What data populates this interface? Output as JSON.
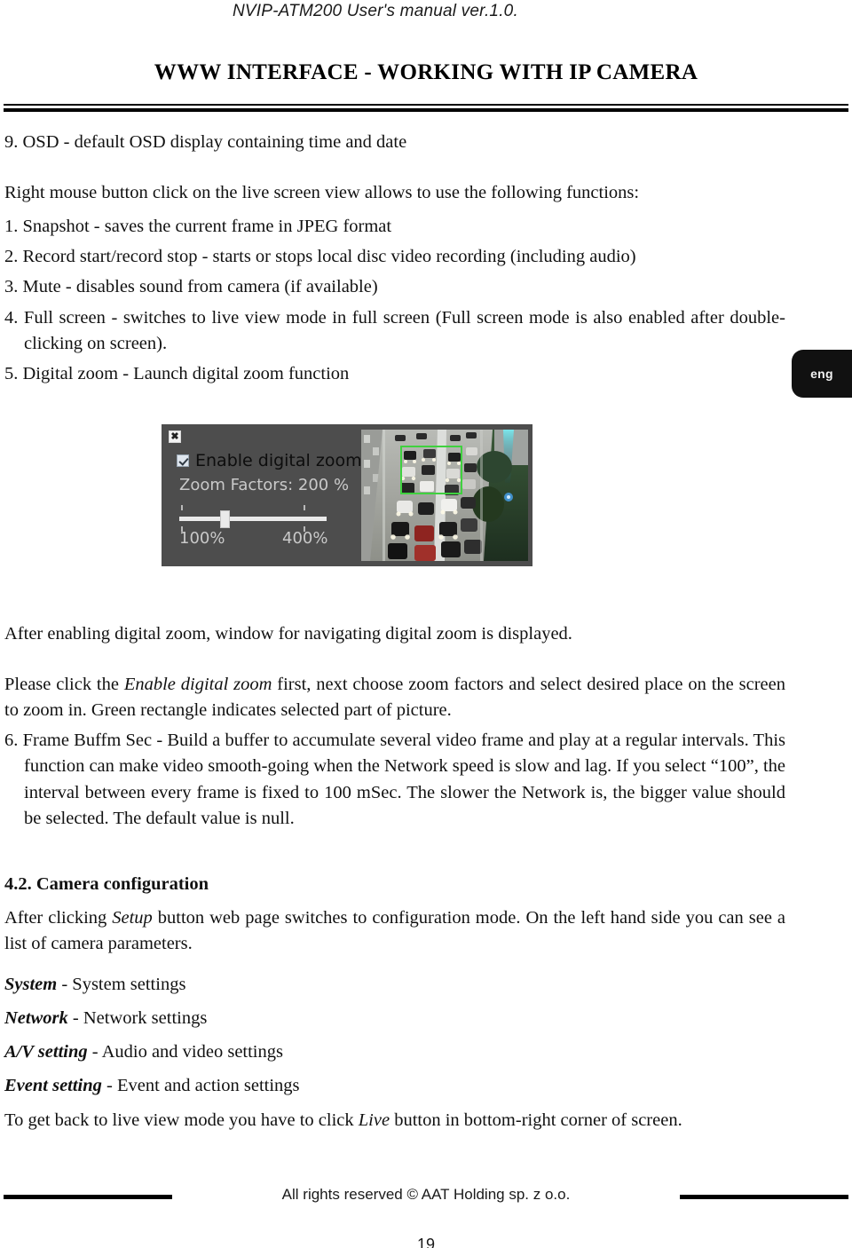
{
  "header": {
    "running_head": "NVIP-ATM200 User's manual ver.1.0.",
    "title": "WWW INTERFACE - WORKING WITH IP CAMERA"
  },
  "language_tab": {
    "label": "eng"
  },
  "body": {
    "item9": "9. OSD - default OSD display containing time and date",
    "intro": "Right mouse button click on the live screen view allows to use the following functions:",
    "item1": "1. Snapshot - saves the current frame in JPEG format",
    "item2": "2. Record start/record stop - starts or stops local disc video recording (including audio)",
    "item3": "3. Mute - disables sound from camera (if available)",
    "item4": "4. Full screen - switches to live view mode in full screen (Full screen mode is also enabled after double-clicking on screen).",
    "item5": "5. Digital zoom - Launch digital zoom function",
    "after_enabling": "After enabling digital zoom, window for navigating digital zoom is displayed.",
    "please_click_pre": "Please click the ",
    "please_click_em": "Enable digital zoom",
    "please_click_post": " first, next choose zoom factors and select desired place on the screen  to zoom in. Green rectangle indicates selected part of picture.",
    "item6": "6. Frame Buffm Sec - Build a buffer to accumulate several video frame and play at a regular intervals. This function can make video smooth-going when the Network speed is slow and lag. If you select “100”, the interval between every frame is fixed to 100 mSec. The slower the Network is, the bigger value should be selected. The default value is null.",
    "section_heading": "4.2. Camera configuration",
    "after_setup_pre": "After clicking ",
    "after_setup_em": "Setup",
    "after_setup_post": " button web page switches to configuration mode. On the left hand side you can see a list of camera parameters.",
    "param_system_term": "System",
    "param_system_desc": " - System settings",
    "param_network_term": "Network",
    "param_network_desc": " - Network settings",
    "param_av_term": "A/V setting",
    "param_av_desc": " - Audio and video settings",
    "param_event_term": "Event setting",
    "param_event_desc": " - Event and action settings",
    "get_back_pre": "To get back to live view mode you have to click ",
    "get_back_em": "Live",
    "get_back_post": " button in bottom-right corner of screen."
  },
  "figure": {
    "close_label": "✖",
    "enable_checkbox_label": "Enable digital zoom",
    "zoom_factors_label": "Zoom Factors: 200  %",
    "slider_min": "100%",
    "slider_max": "400%",
    "colors": {
      "dialog_background": "#4d4d4d",
      "selection_rectangle": "#3fd13f",
      "muted_text": "#c9c9c9"
    }
  },
  "footer": {
    "copyright": "All rights reserved © AAT Holding sp. z o.o.",
    "page_number": "19"
  }
}
